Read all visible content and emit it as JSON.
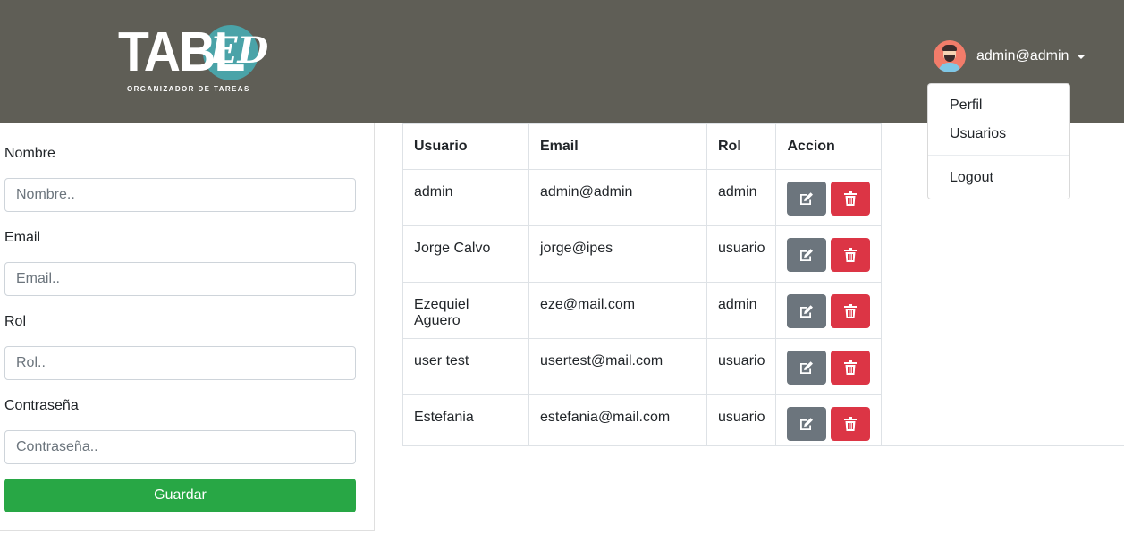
{
  "brand": {
    "logo_text": "TABL",
    "logo_accent": "ED",
    "tagline": "ORGANIZADOR DE TAREAS"
  },
  "user": {
    "name": "admin@admin"
  },
  "dropdown": {
    "items": [
      "Perfil",
      "Usuarios",
      "Logout"
    ]
  },
  "form": {
    "fields": [
      {
        "label": "Nombre",
        "placeholder": "Nombre..",
        "value": ""
      },
      {
        "label": "Email",
        "placeholder": "Email..",
        "value": ""
      },
      {
        "label": "Rol",
        "placeholder": "Rol..",
        "value": ""
      },
      {
        "label": "Contraseña",
        "placeholder": "Contraseña..",
        "value": ""
      }
    ],
    "submit_label": "Guardar"
  },
  "table": {
    "headers": [
      "Usuario",
      "Email",
      "Rol",
      "Accion"
    ],
    "rows": [
      {
        "usuario": "admin",
        "email": "admin@admin",
        "rol": "admin"
      },
      {
        "usuario": "Jorge Calvo",
        "email": "jorge@ipes",
        "rol": "usuario"
      },
      {
        "usuario": "Ezequiel Aguero",
        "email": "eze@mail.com",
        "rol": "admin"
      },
      {
        "usuario": "user test",
        "email": "usertest@mail.com",
        "rol": "usuario"
      },
      {
        "usuario": "Estefania",
        "email": "estefania@mail.com",
        "rol": "usuario"
      }
    ],
    "actions": {
      "edit_icon": "edit-icon",
      "delete_icon": "trash-icon"
    }
  },
  "colors": {
    "navbar": "#5f5e56",
    "logo_circle": "#4aa3a8",
    "save": "#28a745",
    "edit": "#6c757d",
    "delete": "#dc3545"
  }
}
